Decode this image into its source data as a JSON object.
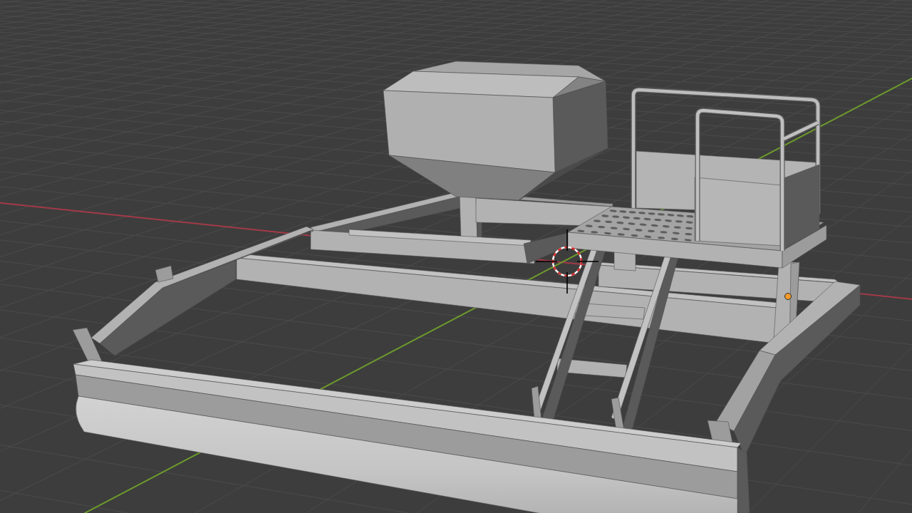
{
  "viewport": {
    "axes": [
      {
        "kind": "x",
        "color": "#a33a48"
      },
      {
        "kind": "y",
        "color": "#6d9a2c"
      }
    ]
  }
}
